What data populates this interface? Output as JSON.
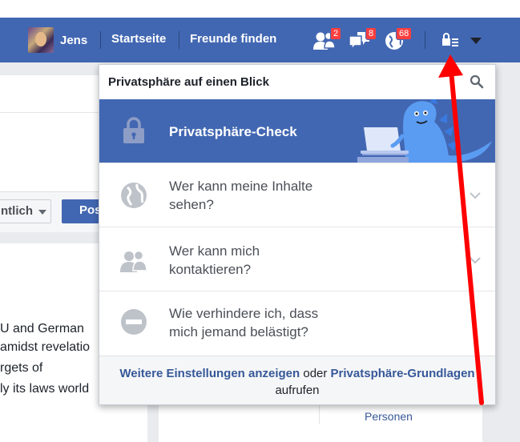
{
  "header": {
    "profile_name": "Jens",
    "nav": [
      "Startseite",
      "Freunde finden"
    ],
    "badges": {
      "friend_requests": "2",
      "messages": "8",
      "notifications": "68"
    }
  },
  "icons": {
    "friends": "friends-icon",
    "messages": "messages-icon",
    "notifications": "globe-icon",
    "privacy": "lock-menu-icon",
    "account": "caret-down-icon"
  },
  "background": {
    "visibility_button": "ntlich",
    "post_button": "Pos",
    "story_lines": [
      "U and German",
      "amidst revelatio",
      "rgets of",
      "ly its laws world"
    ],
    "side_panel_link": "Personen"
  },
  "privacy_dropdown": {
    "title": "Privatsphäre auf einen Blick",
    "hero_label": "Privatsphäre-Check",
    "items": [
      {
        "label": "Wer kann meine Inhalte sehen?",
        "line1": "Wer kann meine Inhalte",
        "line2": "sehen?",
        "icon": "globe-icon"
      },
      {
        "label": "Wer kann mich kontaktieren?",
        "line1": "Wer kann mich",
        "line2": "kontaktieren?",
        "icon": "people-icon"
      },
      {
        "label": "Wie verhindere ich, dass mich jemand belästigt?",
        "line1": "Wie verhindere ich, dass",
        "line2": "mich jemand belästigt?",
        "icon": "block-icon"
      }
    ],
    "footer": {
      "link1": "Weitere Einstellungen anzeigen",
      "connector": " oder ",
      "link2": "Privatsphäre-Grundlagen",
      "suffix": "aufrufen"
    }
  },
  "colors": {
    "brand_blue": "#4267b2",
    "badge_red": "#fa3e3e",
    "annotation_arrow": "#ff0000"
  }
}
